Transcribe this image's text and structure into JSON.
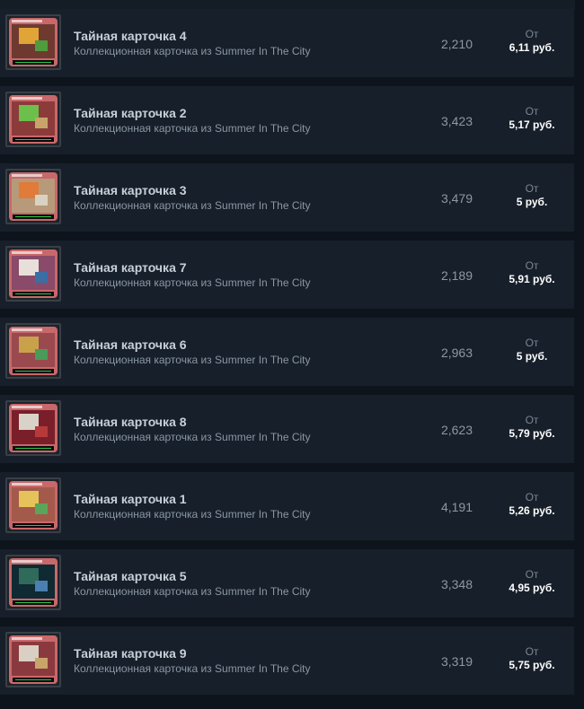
{
  "listings": [
    {
      "name": "Тайная карточка 4",
      "description": "Коллекционная карточка из Summer In The City",
      "quantity": "2,210",
      "from_label": "От",
      "price": "6,11 руб.",
      "thumb_colors": {
        "frame": "#c8686a",
        "art": "#6e3a2f",
        "accent1": "#e0a437",
        "accent2": "#4f9b3e"
      }
    },
    {
      "name": "Тайная карточка 2",
      "description": "Коллекционная карточка из Summer In The City",
      "quantity": "3,423",
      "from_label": "От",
      "price": "5,17 руб.",
      "thumb_colors": {
        "frame": "#c8686a",
        "art": "#8c3b3b",
        "accent1": "#6bbf4a",
        "accent2": "#c9a46a"
      }
    },
    {
      "name": "Тайная карточка 3",
      "description": "Коллекционная карточка из Summer In The City",
      "quantity": "3,479",
      "from_label": "От",
      "price": "5 руб.",
      "thumb_colors": {
        "frame": "#c8686a",
        "art": "#b79a7a",
        "accent1": "#e07b39",
        "accent2": "#d9d2c2"
      }
    },
    {
      "name": "Тайная карточка 7",
      "description": "Коллекционная карточка из Summer In The City",
      "quantity": "2,189",
      "from_label": "От",
      "price": "5,91 руб.",
      "thumb_colors": {
        "frame": "#c8686a",
        "art": "#8a4a6a",
        "accent1": "#e7e0da",
        "accent2": "#3a6ea5"
      }
    },
    {
      "name": "Тайная карточка 6",
      "description": "Коллекционная карточка из Summer In The City",
      "quantity": "2,963",
      "from_label": "От",
      "price": "5 руб.",
      "thumb_colors": {
        "frame": "#c8686a",
        "art": "#9a4a4f",
        "accent1": "#c9a14b",
        "accent2": "#4a9a5a"
      }
    },
    {
      "name": "Тайная карточка 8",
      "description": "Коллекционная карточка из Summer In The City",
      "quantity": "2,623",
      "from_label": "От",
      "price": "5,79 руб.",
      "thumb_colors": {
        "frame": "#c8686a",
        "art": "#7a1f2a",
        "accent1": "#d9d2c8",
        "accent2": "#b73a3a"
      }
    },
    {
      "name": "Тайная карточка 1",
      "description": "Коллекционная карточка из Summer In The City",
      "quantity": "4,191",
      "from_label": "От",
      "price": "5,26 руб.",
      "thumb_colors": {
        "frame": "#c8686a",
        "art": "#a35a4a",
        "accent1": "#e6c35a",
        "accent2": "#5aa55a"
      }
    },
    {
      "name": "Тайная карточка 5",
      "description": "Коллекционная карточка из Summer In The City",
      "quantity": "3,348",
      "from_label": "От",
      "price": "4,95 руб.",
      "thumb_colors": {
        "frame": "#c8686a",
        "art": "#0f2a33",
        "accent1": "#2f6a5a",
        "accent2": "#4a7fb0"
      }
    },
    {
      "name": "Тайная карточка 9",
      "description": "Коллекционная карточка из Summer In The City",
      "quantity": "3,319",
      "from_label": "От",
      "price": "5,75 руб.",
      "thumb_colors": {
        "frame": "#c8686a",
        "art": "#8a3a3f",
        "accent1": "#d9cfc3",
        "accent2": "#c9a46a"
      }
    }
  ]
}
